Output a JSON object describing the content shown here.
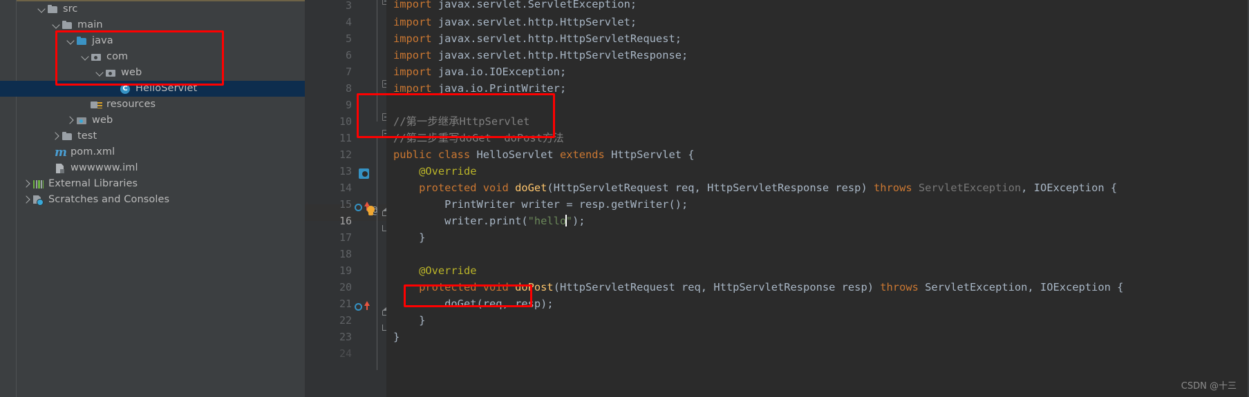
{
  "colors": {
    "sidebar_bg": "#3c3f41",
    "editor_bg": "#2b2b2b",
    "gutter_bg": "#313335",
    "selection_bg": "#0d2d4e",
    "current_line_bg": "#323232",
    "annotation_red": "#ff0000",
    "keyword": "#cc7832",
    "string": "#6a8759",
    "method": "#ffc66d",
    "annotation_token": "#bbb529",
    "comment": "#808080",
    "identifier": "#a9b7c6",
    "line_number": "#606366"
  },
  "sidebar": {
    "name": "project-tree",
    "items": [
      {
        "label": "src",
        "icon": "folder-icon",
        "indent": 0,
        "twisty": "open",
        "selected": false
      },
      {
        "label": "main",
        "icon": "folder-icon",
        "indent": 1,
        "twisty": "open",
        "selected": false
      },
      {
        "label": "java",
        "icon": "source-folder-icon",
        "indent": 2,
        "twisty": "open",
        "selected": false
      },
      {
        "label": "com",
        "icon": "package-icon",
        "indent": 3,
        "twisty": "open",
        "selected": false
      },
      {
        "label": "web",
        "icon": "package-icon",
        "indent": 4,
        "twisty": "open",
        "selected": false
      },
      {
        "label": "HelloServlet",
        "icon": "java-class-icon",
        "indent": 5,
        "twisty": "none",
        "selected": true
      },
      {
        "label": "resources",
        "icon": "resources-folder-icon",
        "indent": 3,
        "twisty": "none",
        "selected": false
      },
      {
        "label": "web",
        "icon": "web-folder-icon",
        "indent": 2,
        "twisty": "closed",
        "selected": false
      },
      {
        "label": "test",
        "icon": "folder-icon",
        "indent": 1,
        "twisty": "closed",
        "selected": false
      },
      {
        "label": "pom.xml",
        "icon": "maven-icon",
        "indent": 1,
        "twisty": "none",
        "selected": false
      },
      {
        "label": "wwwwww.iml",
        "icon": "module-iml-icon",
        "indent": 1,
        "twisty": "none",
        "selected": false
      },
      {
        "label": "External Libraries",
        "icon": "external-libraries-icon",
        "indent": 0,
        "twisty": "closed",
        "selected": false
      },
      {
        "label": "Scratches and Consoles",
        "icon": "scratches-icon",
        "indent": 0,
        "twisty": "closed",
        "selected": false
      }
    ]
  },
  "editor": {
    "name": "code-editor",
    "language": "java",
    "file": "HelloServlet",
    "current_line": 16,
    "caret": {
      "line": 16,
      "after_text": "hello"
    },
    "lines": [
      {
        "n": 3,
        "text": "import javax.servlet.ServletException;",
        "clipped_top": true
      },
      {
        "n": 4,
        "text": "import javax.servlet.http.HttpServlet;"
      },
      {
        "n": 5,
        "text": "import javax.servlet.http.HttpServletRequest;"
      },
      {
        "n": 6,
        "text": "import javax.servlet.http.HttpServletResponse;"
      },
      {
        "n": 7,
        "text": "import java.io.IOException;"
      },
      {
        "n": 8,
        "text": "import java.io.PrintWriter;"
      },
      {
        "n": 9,
        "text": ""
      },
      {
        "n": 10,
        "text": "//第一步继承HttpServlet"
      },
      {
        "n": 11,
        "text": "//第二步重写doGet  doPost方法"
      },
      {
        "n": 12,
        "text": "public class HelloServlet extends HttpServlet {"
      },
      {
        "n": 13,
        "text": "    @Override"
      },
      {
        "n": 14,
        "text": "    protected void doGet(HttpServletRequest req, HttpServletResponse resp) throws ServletException, IOException {"
      },
      {
        "n": 15,
        "text": "        PrintWriter writer = resp.getWriter();"
      },
      {
        "n": 16,
        "text": "        writer.print(\"hello\");"
      },
      {
        "n": 17,
        "text": "    }"
      },
      {
        "n": 18,
        "text": ""
      },
      {
        "n": 19,
        "text": "    @Override"
      },
      {
        "n": 20,
        "text": "    protected void doPost(HttpServletRequest req, HttpServletResponse resp) throws ServletException, IOException {"
      },
      {
        "n": 21,
        "text": "        doGet(req, resp);"
      },
      {
        "n": 22,
        "text": "    }"
      },
      {
        "n": 23,
        "text": "}"
      },
      {
        "n": 24,
        "text": "",
        "clipped_bottom": true
      }
    ],
    "gutter_icons": [
      {
        "line": 12,
        "icon": "web-class-marker-icon"
      },
      {
        "line": 14,
        "icon": "overriding-method-icon"
      },
      {
        "line": 14,
        "icon": "implementing-arrow-icon"
      },
      {
        "line": 14,
        "icon": "annotation-at-icon"
      },
      {
        "line": 16,
        "icon": "intention-bulb-icon"
      },
      {
        "line": 20,
        "icon": "overriding-method-icon"
      },
      {
        "line": 20,
        "icon": "implementing-arrow-icon"
      }
    ],
    "tokens": {
      "keywords": [
        "import",
        "public",
        "class",
        "extends",
        "protected",
        "void",
        "throws"
      ],
      "annotations": [
        "@Override"
      ],
      "methods": [
        "doGet",
        "doPost",
        "print",
        "getWriter"
      ],
      "strings": [
        "\"hello\""
      ],
      "dimmed": [
        "ServletException"
      ]
    }
  },
  "annotations": {
    "name": "red-highlight-boxes",
    "boxes": [
      {
        "id": "sidebar-package-path-box",
        "target": "java / com / web / HelloServlet"
      },
      {
        "id": "comment-steps-box",
        "target": "//第一步继承HttpServlet  //第二步重写doGet  doPost方法"
      },
      {
        "id": "doget-call-box",
        "target": "doGet(req, resp);"
      }
    ]
  },
  "watermark": {
    "text": "CSDN @十三"
  }
}
